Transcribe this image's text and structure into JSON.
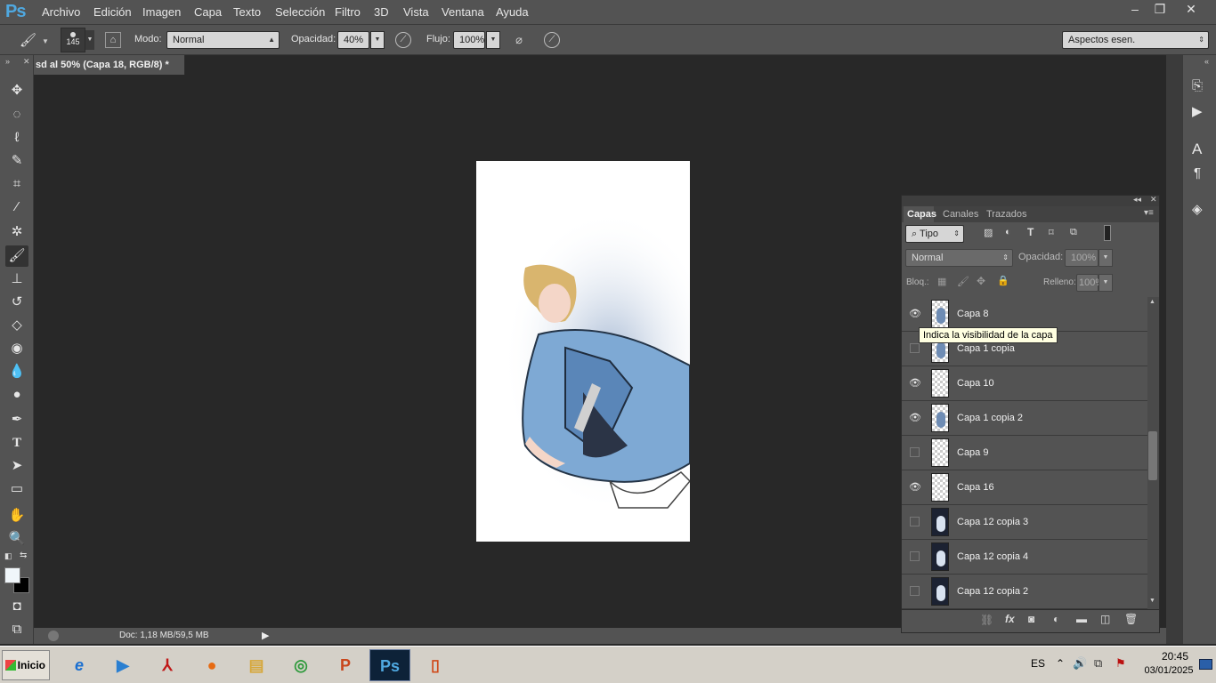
{
  "app": {
    "logo": "Ps"
  },
  "menu": [
    "Archivo",
    "Edición",
    "Imagen",
    "Capa",
    "Texto",
    "Selección",
    "Filtro",
    "3D",
    "Vista",
    "Ventana",
    "Ayuda"
  ],
  "window_controls": {
    "minimize": "–",
    "restore": "❐",
    "close": "✕"
  },
  "options": {
    "brush_size": "145",
    "mode_label": "Modo:",
    "mode_value": "Normal",
    "opacity_label": "Opacidad:",
    "opacity_value": "40%",
    "flow_label": "Flujo:",
    "flow_value": "100%",
    "workspace": "Aspectos esen."
  },
  "document": {
    "tab_title": "sd al 50% (Capa 18, RGB/8) *",
    "tab_close": "✕",
    "status": "Doc: 1,18 MB/59,5 MB"
  },
  "layers_panel": {
    "tabs": [
      "Capas",
      "Canales",
      "Trazados"
    ],
    "filter_kind": "Tipo",
    "blend_mode": "Normal",
    "opacity_label": "Opacidad:",
    "opacity_value": "100%",
    "lock_label": "Bloq.:",
    "fill_label": "Relleno:",
    "fill_value": "100%",
    "tooltip": "Indica la visibilidad de la capa",
    "layers": [
      {
        "name": "Capa 8",
        "visible": true,
        "thumb": "figure"
      },
      {
        "name": "Capa 1 copia",
        "visible": false,
        "thumb": "figure"
      },
      {
        "name": "Capa 10",
        "visible": true,
        "thumb": "empty"
      },
      {
        "name": "Capa 1 copia 2",
        "visible": true,
        "thumb": "figure"
      },
      {
        "name": "Capa 9",
        "visible": false,
        "thumb": "empty"
      },
      {
        "name": "Capa 16",
        "visible": true,
        "thumb": "empty"
      },
      {
        "name": "Capa 12 copia 3",
        "visible": false,
        "thumb": "dark"
      },
      {
        "name": "Capa 12 copia 4",
        "visible": false,
        "thumb": "dark"
      },
      {
        "name": "Capa 12 copia 2",
        "visible": false,
        "thumb": "dark"
      }
    ],
    "footer_fx": "fx"
  },
  "taskbar": {
    "start": "Inicio",
    "lang": "ES",
    "time": "20:45",
    "date": "03/01/2025",
    "apps": [
      "ie",
      "media",
      "acrobat",
      "firefox",
      "explorer",
      "chrome",
      "powerpoint",
      "photoshop",
      "doc"
    ]
  },
  "colors": {
    "ui": "#535353",
    "canvas_bg": "#282828",
    "ps_blue": "#4fa8e0"
  }
}
